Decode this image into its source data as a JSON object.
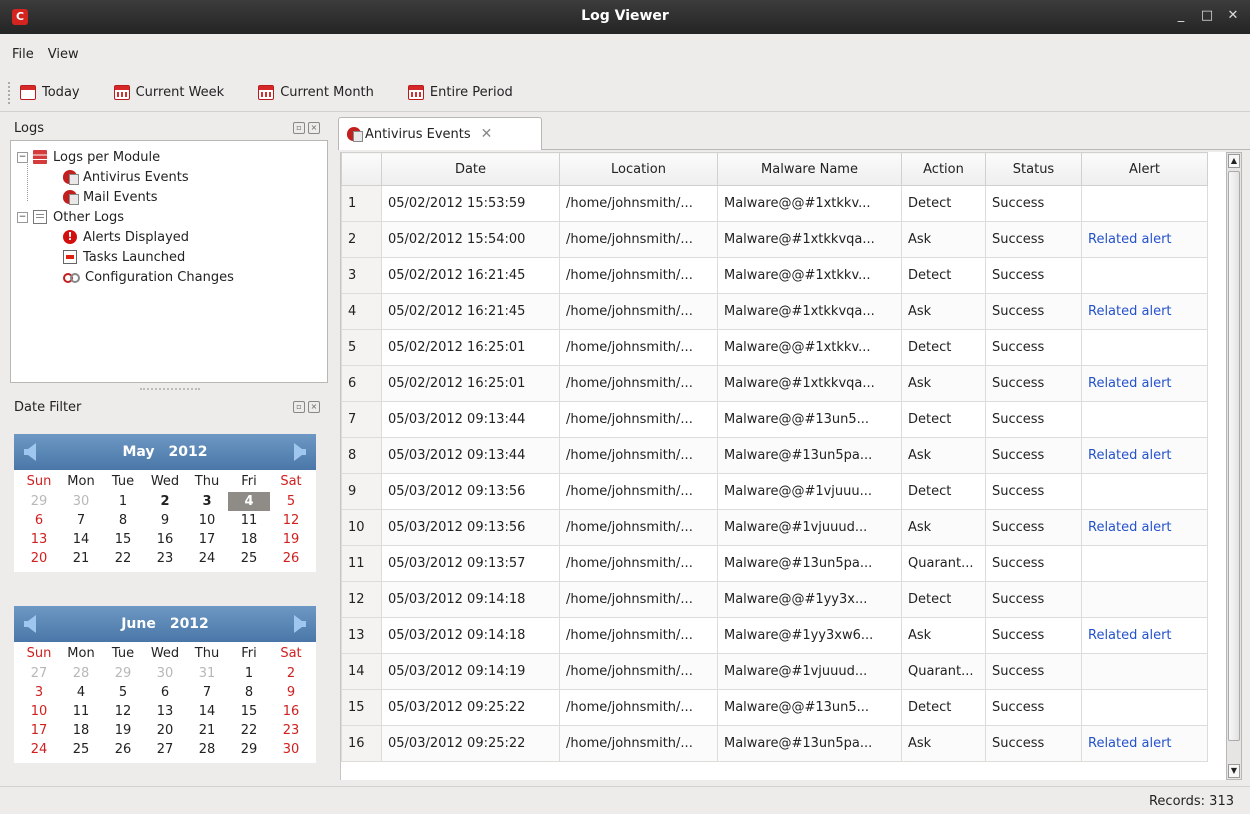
{
  "window": {
    "title": "Log Viewer",
    "logo": "C"
  },
  "menu": {
    "items": [
      "File",
      "View"
    ]
  },
  "toolbar": {
    "today": "Today",
    "week": "Current Week",
    "month": "Current Month",
    "period": "Entire Period"
  },
  "logs_panel": {
    "title": "Logs",
    "tree": {
      "per_module": "Logs per Module",
      "antivirus": "Antivirus Events",
      "mail": "Mail Events",
      "other": "Other Logs",
      "alerts": "Alerts Displayed",
      "tasks": "Tasks Launched",
      "config": "Configuration Changes"
    }
  },
  "date_filter": {
    "title": "Date Filter",
    "weekdays": [
      "Sun",
      "Mon",
      "Tue",
      "Wed",
      "Thu",
      "Fri",
      "Sat"
    ],
    "may": {
      "month": "May",
      "year": "2012",
      "days": [
        "29",
        "30",
        "1",
        "2",
        "3",
        "4",
        "5",
        "6",
        "7",
        "8",
        "9",
        "10",
        "11",
        "12",
        "13",
        "14",
        "15",
        "16",
        "17",
        "18",
        "19",
        "20",
        "21",
        "22",
        "23",
        "24",
        "25",
        "26"
      ]
    },
    "june": {
      "month": "June",
      "year": "2012",
      "days": [
        "27",
        "28",
        "29",
        "30",
        "31",
        "1",
        "2",
        "3",
        "4",
        "5",
        "6",
        "7",
        "8",
        "9",
        "10",
        "11",
        "12",
        "13",
        "14",
        "15",
        "16",
        "17",
        "18",
        "19",
        "20",
        "21",
        "22",
        "23",
        "24",
        "25",
        "26",
        "27",
        "28",
        "29",
        "30"
      ]
    }
  },
  "tab": {
    "label": "Antivirus Events"
  },
  "table": {
    "columns": [
      "",
      "Date",
      "Location",
      "Malware Name",
      "Action",
      "Status",
      "Alert"
    ],
    "rows": [
      [
        "1",
        "05/02/2012 15:53:59",
        "/home/johnsmith/...",
        "Malware@@#1xtkkv...",
        "Detect",
        "Success",
        ""
      ],
      [
        "2",
        "05/02/2012 15:54:00",
        "/home/johnsmith/...",
        "Malware@#1xtkkvqa...",
        "Ask",
        "Success",
        "Related alert"
      ],
      [
        "3",
        "05/02/2012 16:21:45",
        "/home/johnsmith/...",
        "Malware@@#1xtkkv...",
        "Detect",
        "Success",
        ""
      ],
      [
        "4",
        "05/02/2012 16:21:45",
        "/home/johnsmith/...",
        "Malware@#1xtkkvqa...",
        "Ask",
        "Success",
        "Related alert"
      ],
      [
        "5",
        "05/02/2012 16:25:01",
        "/home/johnsmith/...",
        "Malware@@#1xtkkv...",
        "Detect",
        "Success",
        ""
      ],
      [
        "6",
        "05/02/2012 16:25:01",
        "/home/johnsmith/...",
        "Malware@#1xtkkvqa...",
        "Ask",
        "Success",
        "Related alert"
      ],
      [
        "7",
        "05/03/2012 09:13:44",
        "/home/johnsmith/...",
        "Malware@@#13un5...",
        "Detect",
        "Success",
        ""
      ],
      [
        "8",
        "05/03/2012 09:13:44",
        "/home/johnsmith/...",
        "Malware@#13un5pa...",
        "Ask",
        "Success",
        "Related alert"
      ],
      [
        "9",
        "05/03/2012 09:13:56",
        "/home/johnsmith/...",
        "Malware@@#1vjuuu...",
        "Detect",
        "Success",
        ""
      ],
      [
        "10",
        "05/03/2012 09:13:56",
        "/home/johnsmith/...",
        "Malware@#1vjuuud...",
        "Ask",
        "Success",
        "Related alert"
      ],
      [
        "11",
        "05/03/2012 09:13:57",
        "/home/johnsmith/...",
        "Malware@#13un5pa...",
        "Quarant...",
        "Success",
        ""
      ],
      [
        "12",
        "05/03/2012 09:14:18",
        "/home/johnsmith/...",
        "Malware@@#1yy3x...",
        "Detect",
        "Success",
        ""
      ],
      [
        "13",
        "05/03/2012 09:14:18",
        "/home/johnsmith/...",
        "Malware@#1yy3xw6...",
        "Ask",
        "Success",
        "Related alert"
      ],
      [
        "14",
        "05/03/2012 09:14:19",
        "/home/johnsmith/...",
        "Malware@#1vjuuud...",
        "Quarant...",
        "Success",
        ""
      ],
      [
        "15",
        "05/03/2012 09:25:22",
        "/home/johnsmith/...",
        "Malware@@#13un5...",
        "Detect",
        "Success",
        ""
      ],
      [
        "16",
        "05/03/2012 09:25:22",
        "/home/johnsmith/...",
        "Malware@#13un5pa...",
        "Ask",
        "Success",
        "Related alert"
      ]
    ]
  },
  "status": {
    "records": "Records: 313"
  },
  "colors": {
    "accent": "#4a77a8",
    "weekend": "#d01f1f",
    "link": "#2452cc"
  },
  "icons": [
    "app-logo-icon",
    "calendar-icon",
    "module-icon",
    "shield-icon",
    "document-icon",
    "alert-icon",
    "task-icon",
    "config-icon",
    "close-icon",
    "minimize-icon",
    "maximize-icon"
  ]
}
